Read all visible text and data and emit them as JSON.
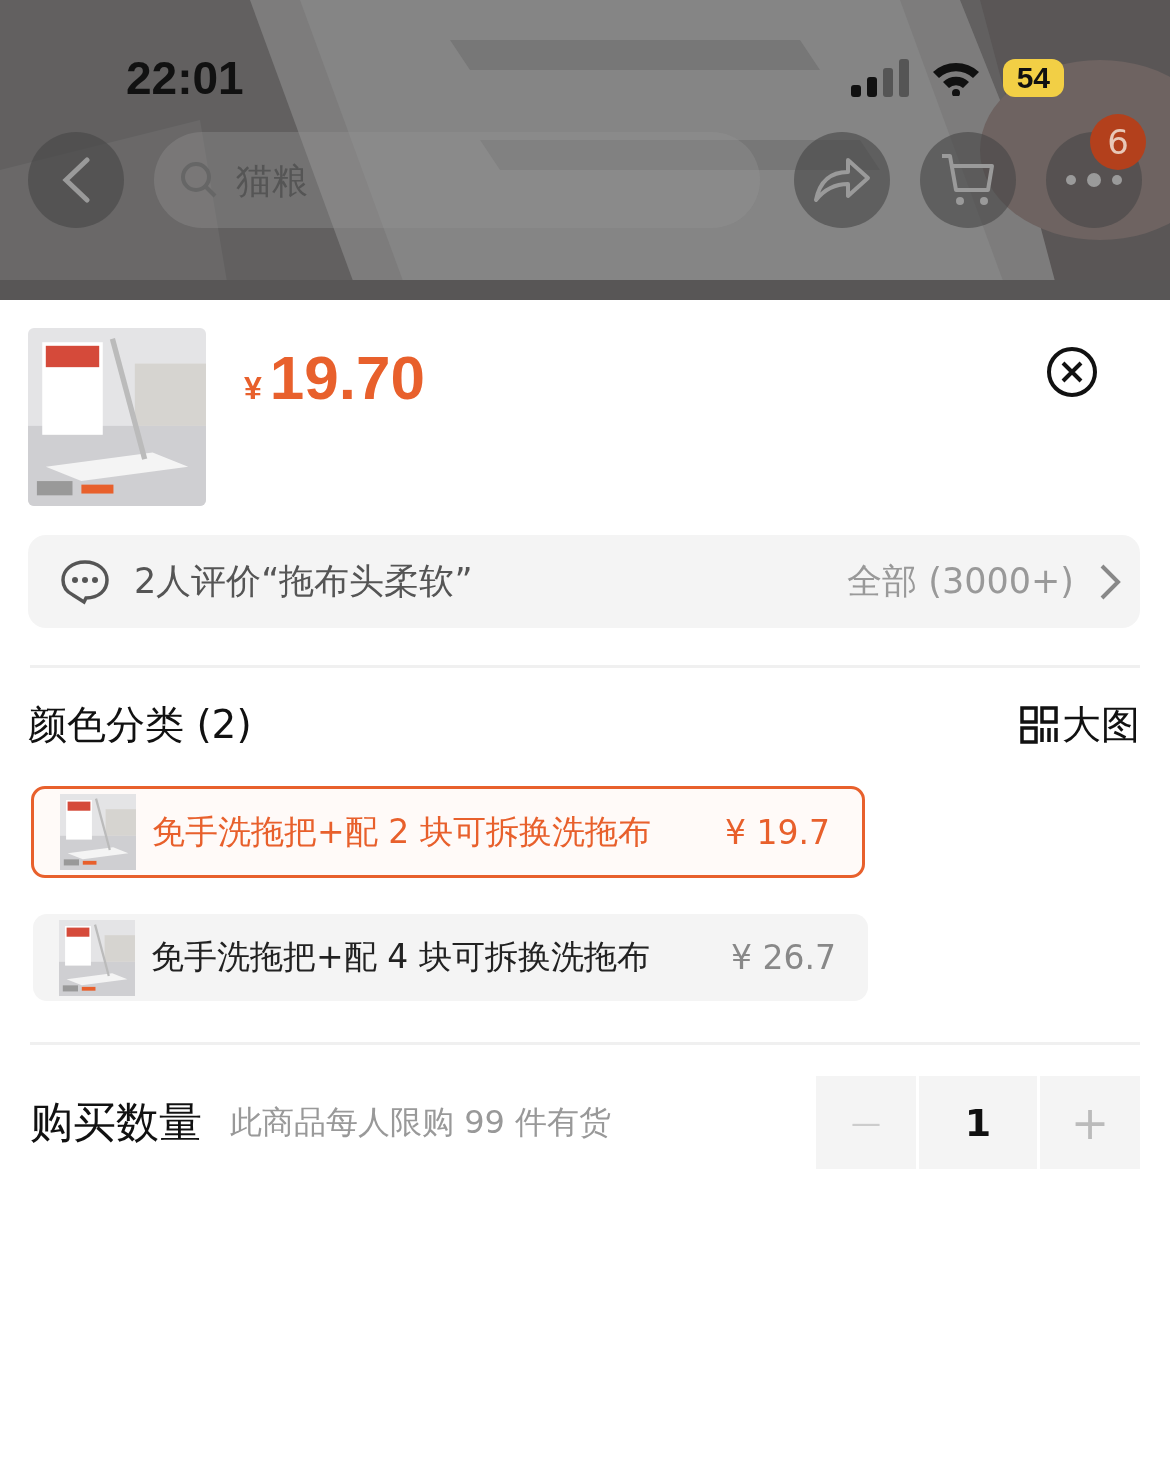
{
  "status_bar": {
    "time": "22:01",
    "battery": "54"
  },
  "nav": {
    "search": {
      "placeholder": "猫粮"
    },
    "badge": "6"
  },
  "product": {
    "currency": "¥",
    "price": "19.70"
  },
  "review_bar": {
    "text": "2人评价“拖布头柔软”",
    "link": "全部 (3000+)"
  },
  "options": {
    "title": "颜色分类 (2)",
    "view_large": "大图",
    "variants": [
      {
        "label": "免手洗拖把+配 2 块可拆换洗拖布",
        "price": "¥ 19.7",
        "selected": true
      },
      {
        "label": "免手洗拖把+配 4 块可拆换洗拖布",
        "price": "¥ 26.7",
        "selected": false
      }
    ]
  },
  "quantity": {
    "label": "购买数量",
    "note": "此商品每人限购 99 件有货",
    "minus": "—",
    "value": "1",
    "plus": "+"
  }
}
